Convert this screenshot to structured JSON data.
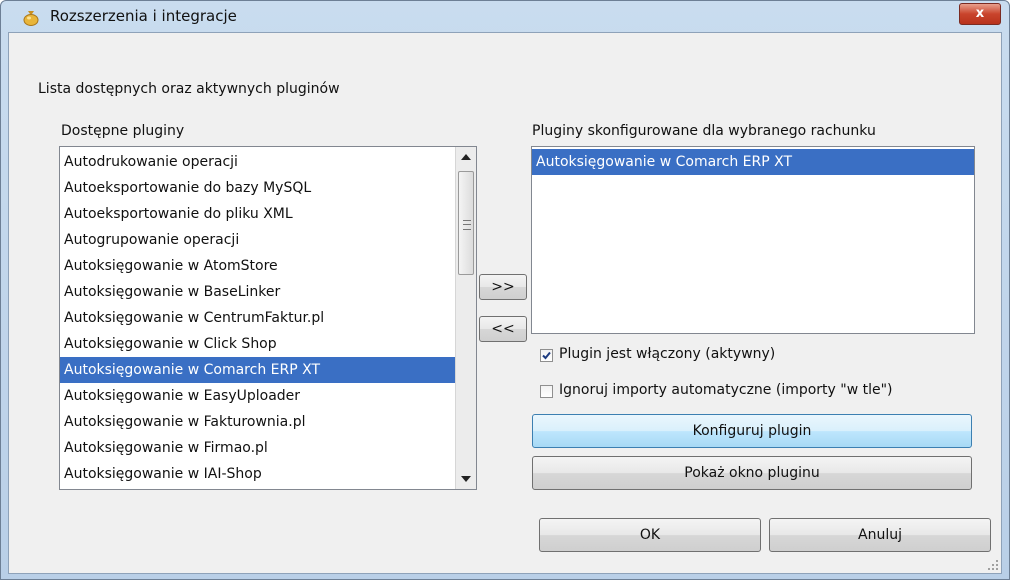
{
  "window": {
    "title": "Rozszerzenia i integracje",
    "close_label": "x"
  },
  "main": {
    "heading": "Lista dostępnych oraz aktywnych pluginów",
    "available": {
      "label": "Dostępne pluginy",
      "items": [
        "Autodrukowanie operacji",
        "Autoeksportowanie do bazy MySQL",
        "Autoeksportowanie do pliku XML",
        "Autogrupowanie operacji",
        "Autoksięgowanie w AtomStore",
        "Autoksięgowanie w BaseLinker",
        "Autoksięgowanie w CentrumFaktur.pl",
        "Autoksięgowanie w Click Shop",
        "Autoksięgowanie w Comarch ERP XT",
        "Autoksięgowanie w EasyUploader",
        "Autoksięgowanie w Fakturownia.pl",
        "Autoksięgowanie w Firmao.pl",
        "Autoksięgowanie w IAI-Shop"
      ],
      "selected_index": 8
    },
    "move_right_label": ">>",
    "move_left_label": "<<",
    "configured": {
      "label": "Pluginy skonfigurowane dla wybranego rachunku",
      "items": [
        "Autoksięgowanie w Comarch ERP XT"
      ],
      "selected_index": 0
    },
    "enabled_checkbox": {
      "label": "Plugin jest włączony (aktywny)",
      "checked": true
    },
    "ignore_checkbox": {
      "label": "Ignoruj importy automatyczne (importy \"w tle\")",
      "checked": false
    },
    "configure_button": "Konfiguruj plugin",
    "show_window_button": "Pokaż okno pluginu",
    "ok_button": "OK",
    "cancel_button": "Anuluj"
  }
}
